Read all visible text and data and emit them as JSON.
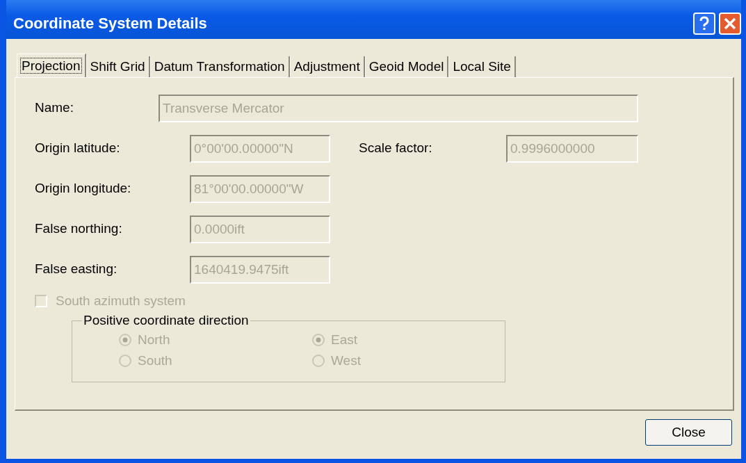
{
  "window": {
    "title": "Coordinate System Details"
  },
  "tabs": [
    {
      "label": "Projection",
      "selected": true
    },
    {
      "label": "Shift Grid",
      "selected": false
    },
    {
      "label": "Datum Transformation",
      "selected": false
    },
    {
      "label": "Adjustment",
      "selected": false
    },
    {
      "label": "Geoid Model",
      "selected": false
    },
    {
      "label": "Local Site",
      "selected": false
    }
  ],
  "name_field": {
    "label": "Name:",
    "value": "Transverse Mercator",
    "disabled": true
  },
  "rows": [
    {
      "left": {
        "label": "Origin latitude:",
        "value": "0°00'00.00000\"N",
        "disabled": true
      },
      "right": {
        "label": "Scale factor:",
        "value": "0.9996000000",
        "disabled": true
      }
    },
    {
      "left": {
        "label": "Origin longitude:",
        "value": "81°00'00.00000\"W",
        "disabled": true
      }
    },
    {
      "left": {
        "label": "False northing:",
        "value": "0.0000ift",
        "disabled": true
      }
    },
    {
      "left": {
        "label": "False easting:",
        "value": "1640419.9475ift",
        "disabled": true
      }
    }
  ],
  "south_azimuth": {
    "label": "South azimuth system",
    "checked": false,
    "disabled": true
  },
  "direction_group": {
    "title": "Positive coordinate direction",
    "columns": [
      [
        {
          "label": "North",
          "selected": true,
          "disabled": true
        },
        {
          "label": "South",
          "selected": false,
          "disabled": true
        }
      ],
      [
        {
          "label": "East",
          "selected": true,
          "disabled": true
        },
        {
          "label": "West",
          "selected": false,
          "disabled": true
        }
      ]
    ]
  },
  "buttons": [
    {
      "label": "Close"
    }
  ]
}
